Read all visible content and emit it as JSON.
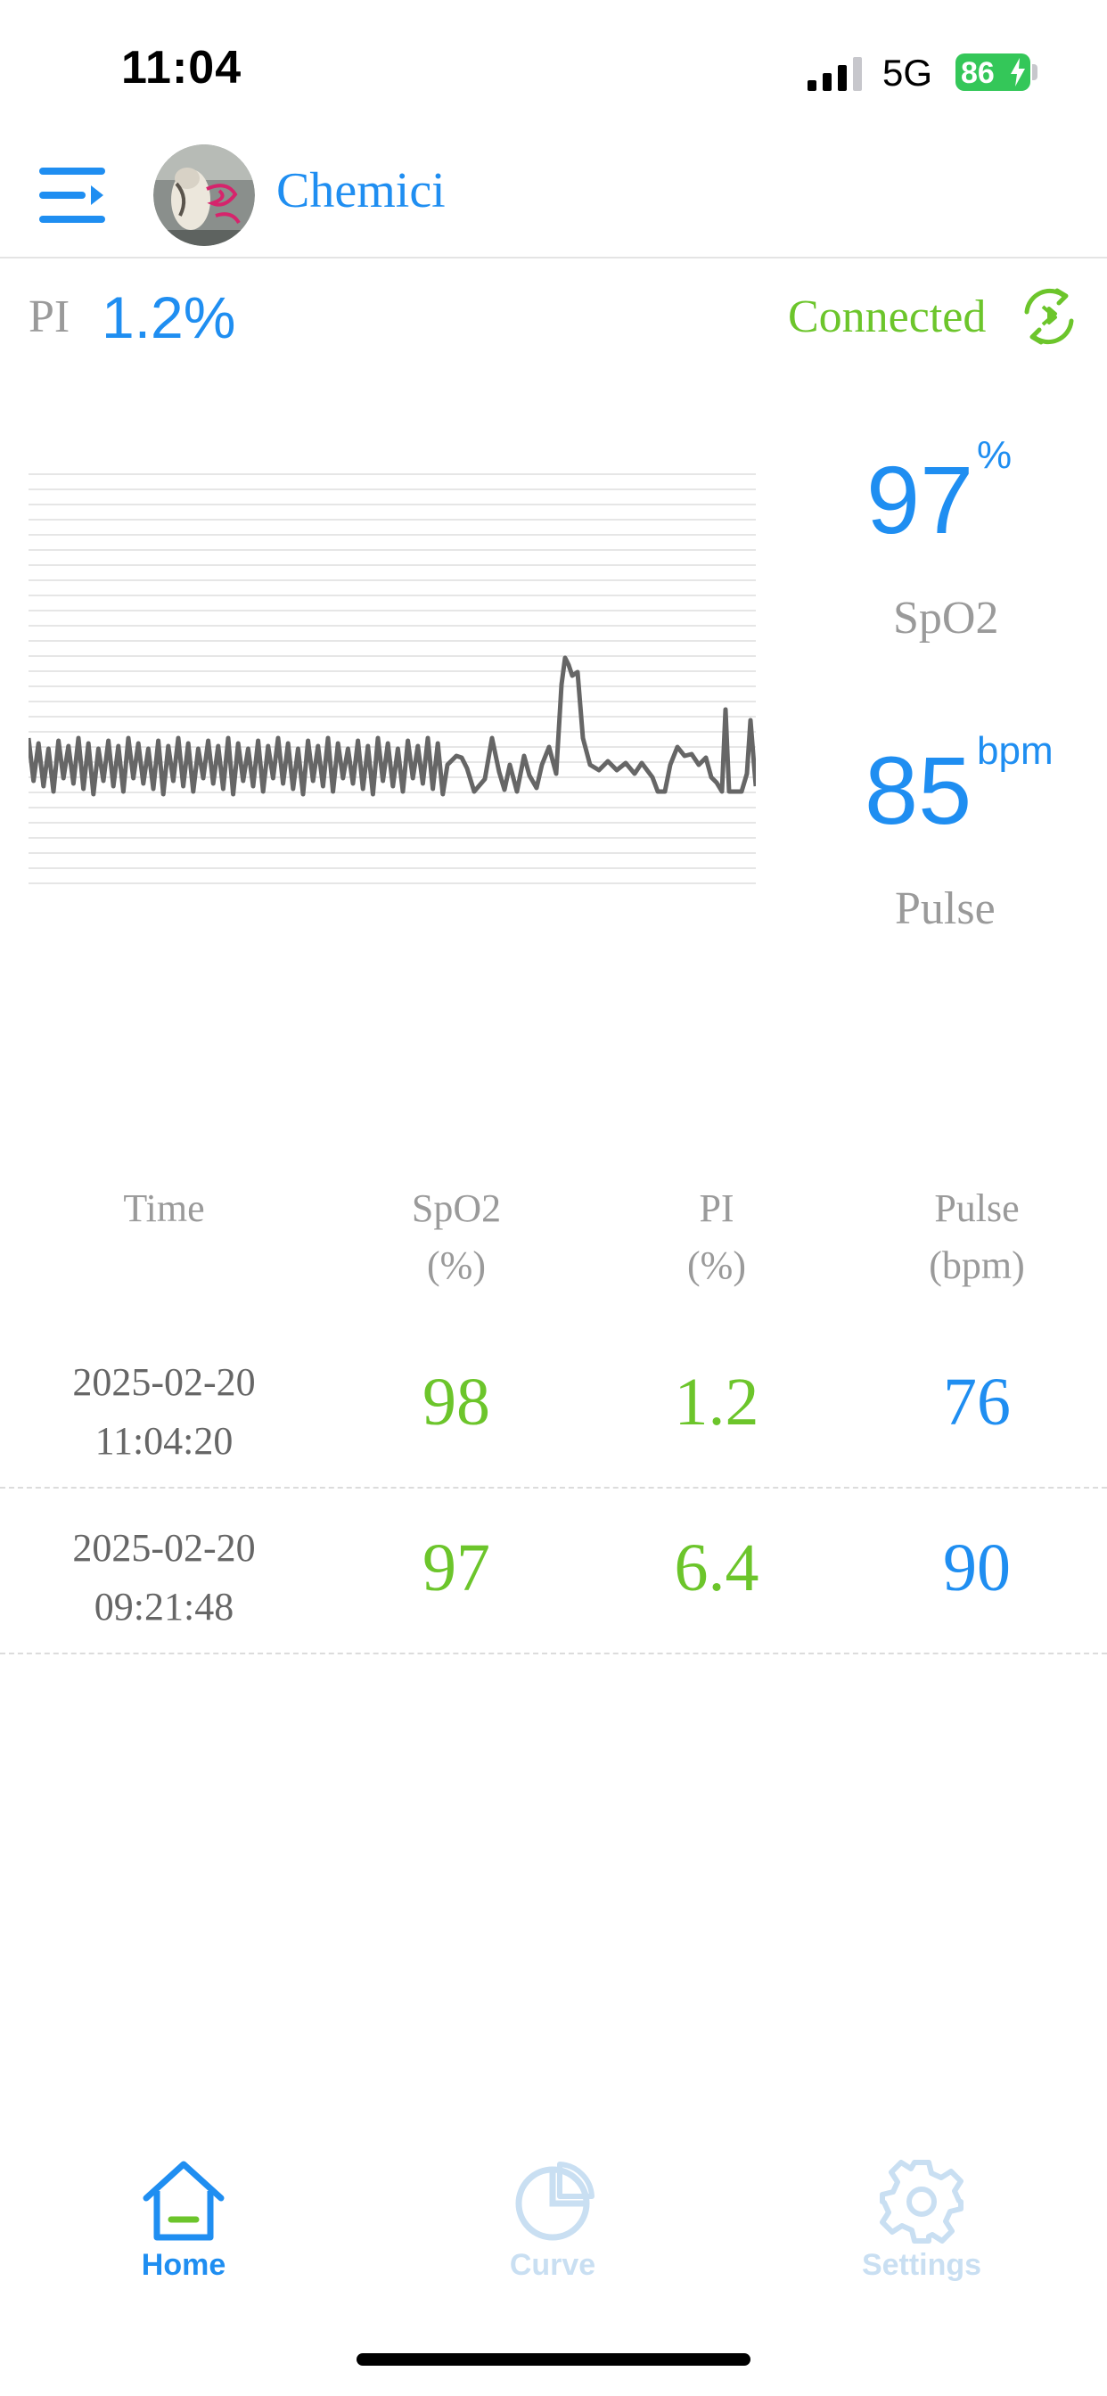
{
  "status_bar": {
    "time": "11:04",
    "network": "5G",
    "battery": "86"
  },
  "header": {
    "username": "Chemici"
  },
  "pi_row": {
    "label": "PI",
    "value": "1.2%",
    "connection_status": "Connected"
  },
  "readings": {
    "spo2": {
      "value": "97",
      "unit": "%",
      "label": "SpO2"
    },
    "pulse": {
      "value": "85",
      "unit": "bpm",
      "label": "Pulse"
    }
  },
  "table": {
    "headers": [
      {
        "line1": "Time",
        "line2": ""
      },
      {
        "line1": "SpO2",
        "line2": "(%)"
      },
      {
        "line1": "PI",
        "line2": "(%)"
      },
      {
        "line1": "Pulse",
        "line2": "(bpm)"
      }
    ],
    "rows": [
      {
        "date": "2025-02-20",
        "time": "11:04:20",
        "spo2": "98",
        "pi": "1.2",
        "pulse": "76"
      },
      {
        "date": "2025-02-20",
        "time": "09:21:48",
        "spo2": "97",
        "pi": "6.4",
        "pulse": "90"
      }
    ]
  },
  "tabs": [
    {
      "label": "Home",
      "icon": "home-icon",
      "active": true
    },
    {
      "label": "Curve",
      "icon": "pie-chart-icon",
      "active": false
    },
    {
      "label": "Settings",
      "icon": "gear-icon",
      "active": false
    }
  ],
  "colors": {
    "accent_blue": "#1f8ef1",
    "connected_green": "#6cc52b",
    "value_green": "#6cc52b",
    "inactive_tab": "#c9dff2",
    "waveform": "#666666"
  }
}
